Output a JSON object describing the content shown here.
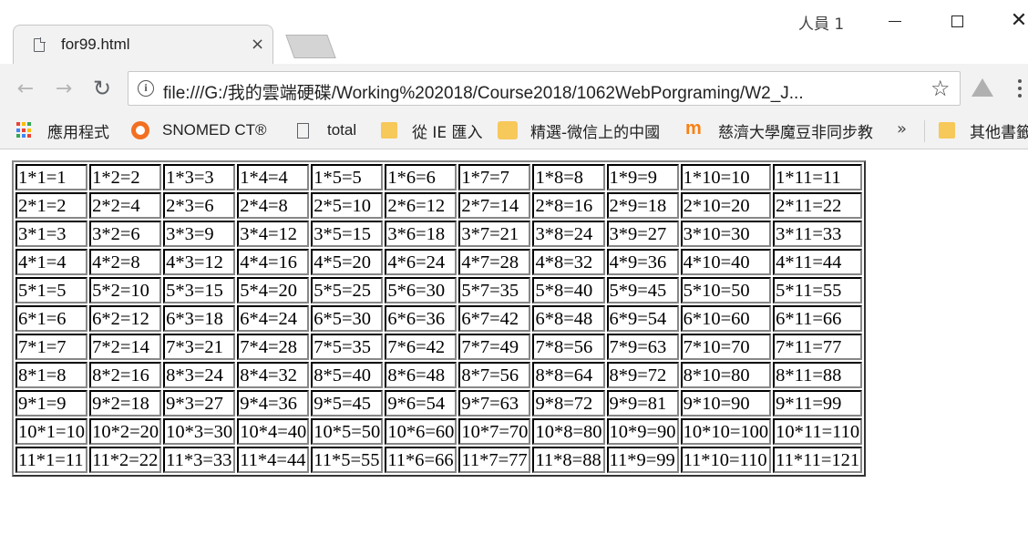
{
  "tab": {
    "title": "for99.html",
    "close_glyph": "×"
  },
  "window": {
    "profile_name": "人員 1",
    "close_glyph": "✕"
  },
  "toolbar": {
    "back_glyph": "←",
    "forward_glyph": "→",
    "reload_glyph": "↻",
    "url": "file:///G:/我的雲端硬碟/Working%202018/Course2018/1062WebPorgraming/W2_J...",
    "star_glyph": "☆"
  },
  "bookmarks": {
    "items": [
      {
        "label": "應用程式",
        "icon": "apps-icon"
      },
      {
        "label": "SNOMED CT®",
        "icon": "snomed-icon"
      },
      {
        "label": "total",
        "icon": "document-icon"
      },
      {
        "label": "從 IE 匯入",
        "icon": "folder-icon"
      },
      {
        "label": "精選-微信上的中國",
        "icon": "wechat-icon"
      },
      {
        "label": "慈濟大學魔豆非同步教",
        "icon": "moodle-icon"
      }
    ],
    "overflow_glyph": "»",
    "other": {
      "label": "其他書籤",
      "icon": "folder-icon"
    }
  },
  "colors": {
    "chrome_bg": "#f2f2f2",
    "folder": "#f7c85a",
    "snomed": "#f36f21"
  },
  "table": {
    "rows": [
      [
        "1*1=1",
        "1*2=2",
        "1*3=3",
        "1*4=4",
        "1*5=5",
        "1*6=6",
        "1*7=7",
        "1*8=8",
        "1*9=9",
        "1*10=10",
        "1*11=11"
      ],
      [
        "2*1=2",
        "2*2=4",
        "2*3=6",
        "2*4=8",
        "2*5=10",
        "2*6=12",
        "2*7=14",
        "2*8=16",
        "2*9=18",
        "2*10=20",
        "2*11=22"
      ],
      [
        "3*1=3",
        "3*2=6",
        "3*3=9",
        "3*4=12",
        "3*5=15",
        "3*6=18",
        "3*7=21",
        "3*8=24",
        "3*9=27",
        "3*10=30",
        "3*11=33"
      ],
      [
        "4*1=4",
        "4*2=8",
        "4*3=12",
        "4*4=16",
        "4*5=20",
        "4*6=24",
        "4*7=28",
        "4*8=32",
        "4*9=36",
        "4*10=40",
        "4*11=44"
      ],
      [
        "5*1=5",
        "5*2=10",
        "5*3=15",
        "5*4=20",
        "5*5=25",
        "5*6=30",
        "5*7=35",
        "5*8=40",
        "5*9=45",
        "5*10=50",
        "5*11=55"
      ],
      [
        "6*1=6",
        "6*2=12",
        "6*3=18",
        "6*4=24",
        "6*5=30",
        "6*6=36",
        "6*7=42",
        "6*8=48",
        "6*9=54",
        "6*10=60",
        "6*11=66"
      ],
      [
        "7*1=7",
        "7*2=14",
        "7*3=21",
        "7*4=28",
        "7*5=35",
        "7*6=42",
        "7*7=49",
        "7*8=56",
        "7*9=63",
        "7*10=70",
        "7*11=77"
      ],
      [
        "8*1=8",
        "8*2=16",
        "8*3=24",
        "8*4=32",
        "8*5=40",
        "8*6=48",
        "8*7=56",
        "8*8=64",
        "8*9=72",
        "8*10=80",
        "8*11=88"
      ],
      [
        "9*1=9",
        "9*2=18",
        "9*3=27",
        "9*4=36",
        "9*5=45",
        "9*6=54",
        "9*7=63",
        "9*8=72",
        "9*9=81",
        "9*10=90",
        "9*11=99"
      ],
      [
        "10*1=10",
        "10*2=20",
        "10*3=30",
        "10*4=40",
        "10*5=50",
        "10*6=60",
        "10*7=70",
        "10*8=80",
        "10*9=90",
        "10*10=100",
        "10*11=110"
      ],
      [
        "11*1=11",
        "11*2=22",
        "11*3=33",
        "11*4=44",
        "11*5=55",
        "11*6=66",
        "11*7=77",
        "11*8=88",
        "11*9=99",
        "11*10=110",
        "11*11=121"
      ]
    ]
  }
}
